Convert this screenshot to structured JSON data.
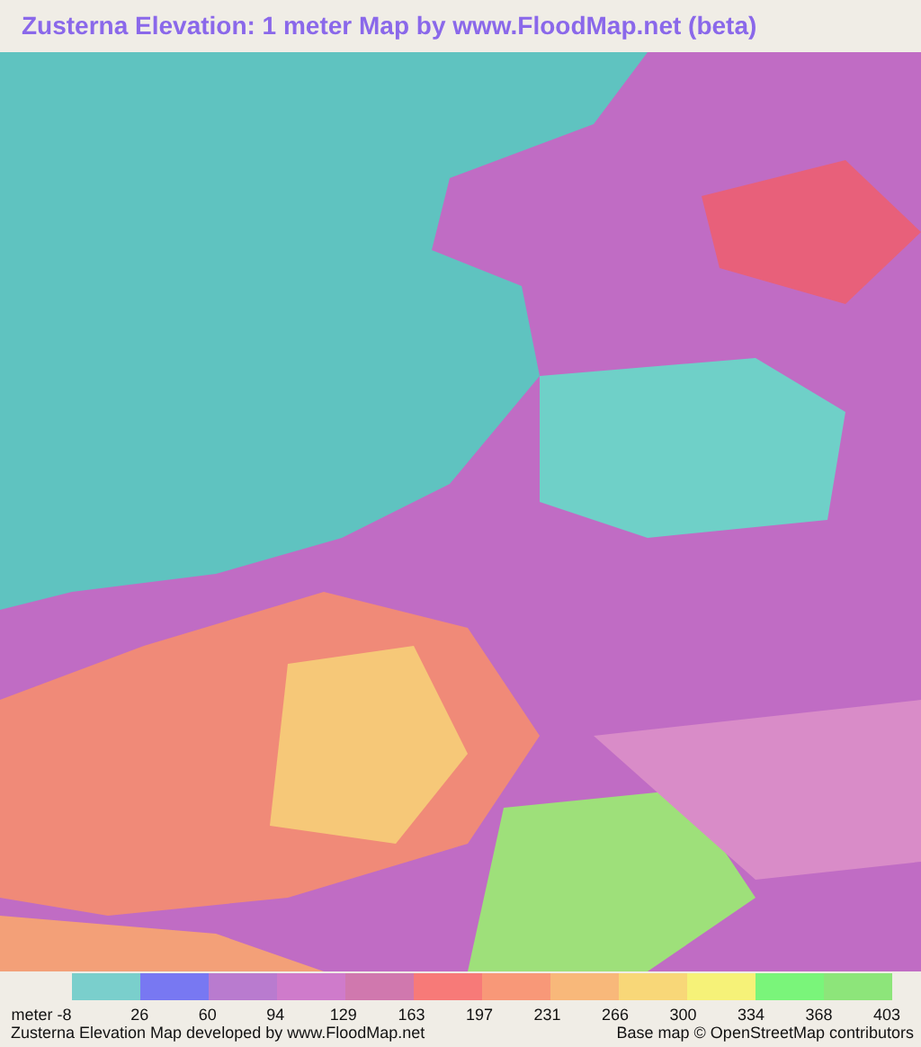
{
  "title": "Zusterna Elevation: 1 meter Map by www.FloodMap.net (beta)",
  "legend": {
    "unit_label": "meter -8",
    "swatches": [
      {
        "color": "#7acfcc"
      },
      {
        "color": "#7878f2"
      },
      {
        "color": "#b97bcf"
      },
      {
        "color": "#cf7bcb"
      },
      {
        "color": "#d078ae"
      },
      {
        "color": "#f77a78"
      },
      {
        "color": "#f89878"
      },
      {
        "color": "#f8b87a"
      },
      {
        "color": "#f8d778"
      },
      {
        "color": "#f6f278"
      },
      {
        "color": "#7af57a"
      },
      {
        "color": "#8de57a"
      }
    ],
    "ticks": [
      "26",
      "60",
      "94",
      "129",
      "163",
      "197",
      "231",
      "266",
      "300",
      "334",
      "368",
      "403"
    ]
  },
  "footer": {
    "credit": "Zusterna Elevation Map developed by www.FloodMap.net",
    "attribution": "Base map © OpenStreetMap contributors"
  }
}
